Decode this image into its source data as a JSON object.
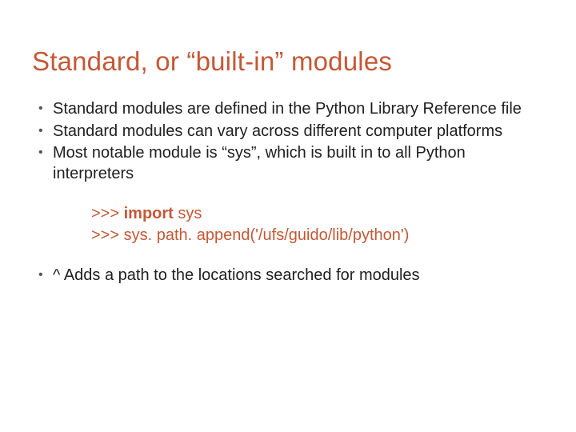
{
  "title": "Standard, or “built-in” modules",
  "bullets_top": [
    "Standard modules are defined in the Python Library Reference file",
    "Standard modules can vary across different computer platforms",
    "Most notable module is “sys”, which is built in to all Python interpreters"
  ],
  "code": {
    "line1": {
      "prompt": ">>> ",
      "keyword": "import",
      "rest": " sys"
    },
    "line2": {
      "prompt": ">>> ",
      "rest": "sys. path. append('/ufs/guido/lib/python')"
    }
  },
  "bullets_bottom": [
    "^ Adds a path to the locations searched for modules"
  ]
}
